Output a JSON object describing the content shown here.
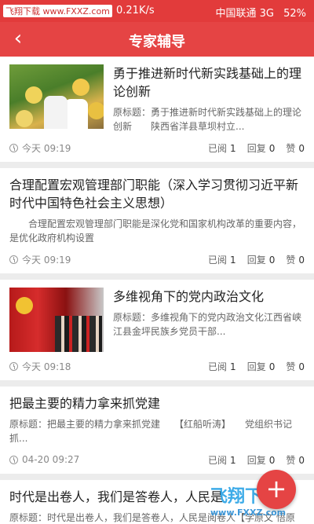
{
  "status_bar": {
    "watermark": "飞翔下载 www.FXXZ.com",
    "speed": "0.21K/s",
    "carrier": "中国联通 3G",
    "battery": "52%"
  },
  "header": {
    "back_icon": "chevron-left-icon",
    "title": "专家辅导"
  },
  "articles": [
    {
      "title": "勇于推进新时代新实践基础上的理论创新",
      "summary": "原标题：勇于推进新时代新实践基础上的理论创新　　陕西省洋县草坝村立...",
      "time": "今天 09:19",
      "read_label": "已阅",
      "read": "1",
      "reply_label": "回复",
      "reply": "0",
      "like_label": "赞",
      "like": "0"
    },
    {
      "title": "合理配置宏观管理部门职能（深入学习贯彻习近平新时代中国特色社会主义思想）",
      "summary": "合理配置宏观管理部门职能是深化党和国家机构改革的重要内容，是优化政府机构设置",
      "time": "今天 09:19",
      "read_label": "已阅",
      "read": "1",
      "reply_label": "回复",
      "reply": "0",
      "like_label": "赞",
      "like": "0"
    },
    {
      "title": "多维视角下的党内政治文化",
      "summary": "原标题：多维视角下的党内政治文化江西省峡江县金坪民族乡党员干部...",
      "time": "今天 09:18",
      "read_label": "已阅",
      "read": "1",
      "reply_label": "回复",
      "reply": "0",
      "like_label": "赞",
      "like": "0"
    },
    {
      "title": "把最主要的精力拿来抓党建",
      "summary": "原标题：把最主要的精力拿来抓党建　　【红船听涛】　　党组织书记抓...",
      "time": "04-20 09:27",
      "read_label": "已阅",
      "read": "1",
      "reply_label": "回复",
      "reply": "0",
      "like_label": "赞",
      "like": "0"
    },
    {
      "title": "时代是出卷人，我们是答卷人，人民是",
      "summary": "原标题：时代是出卷人，我们是答卷人，人民是阅卷人【学原文 悟原理】",
      "time": "",
      "read_label": "",
      "read": "",
      "reply_label": "",
      "reply": "",
      "like_label": "",
      "like": ""
    }
  ],
  "fab": {
    "icon": "plus-icon",
    "label": "+"
  },
  "site_watermark": {
    "brand": "飞翔下载",
    "url": "www.FXXZ.com"
  },
  "colors": {
    "accent": "#e54444",
    "status_bar": "#e23b3b",
    "background": "#ececec"
  }
}
